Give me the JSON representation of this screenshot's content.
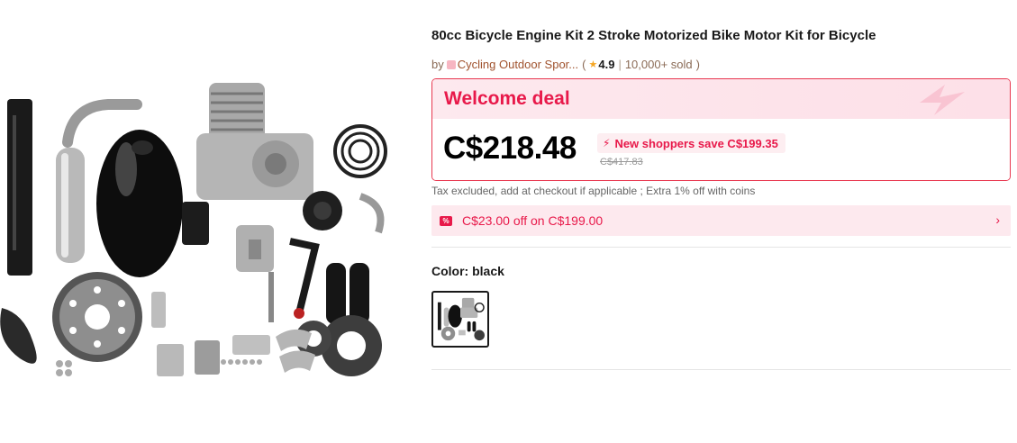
{
  "product": {
    "title": "80cc Bicycle Engine Kit 2 Stroke Motorized Bike Motor Kit for Bicycle",
    "image_alt": "engine-kit-parts-photo"
  },
  "seller": {
    "by": "by",
    "store_name": "Cycling Outdoor Spor...",
    "open_paren": "(",
    "rating": "4.9",
    "separator": "|",
    "sold": "10,000+ sold",
    "close_paren": ")"
  },
  "deal": {
    "title": "Welcome deal",
    "price": "C$218.48",
    "save_text": "New shoppers save C$199.35",
    "original_price": "C$417.83"
  },
  "tax_note": "Tax excluded, add at checkout if applicable ; Extra 1% off with coins",
  "coupon": {
    "badge": "%",
    "text": "C$23.00 off on C$199.00"
  },
  "color": {
    "label": "Color: black",
    "selected": "black"
  },
  "colors": {
    "accent": "#e8194a",
    "deal_bg": "#fde9ee",
    "border": "#e8374f"
  },
  "icons": {
    "star": "star-icon",
    "bolt": "bolt-icon",
    "coupon": "coupon-icon",
    "chevron": "chevron-right-icon"
  }
}
